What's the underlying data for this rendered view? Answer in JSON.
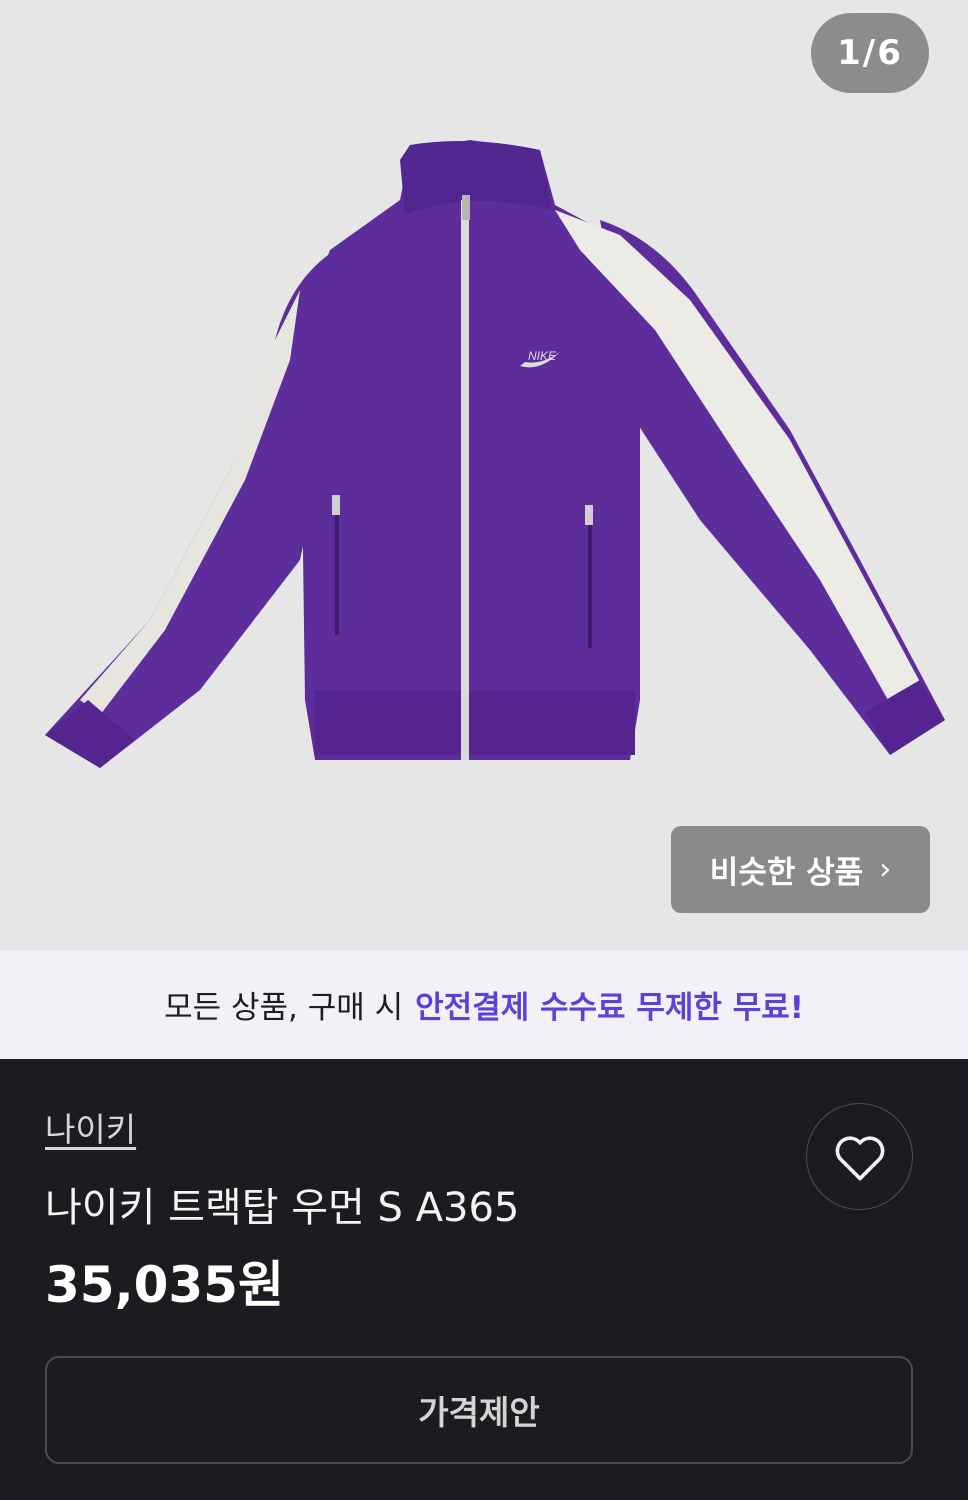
{
  "gallery": {
    "counter": "1/6",
    "similar_label": "비슷한 상품",
    "similar_chevron": "›",
    "image_subject": "purple track jacket with white sleeve stripes",
    "logo_text": "NIKE"
  },
  "banner": {
    "text": "모든 상품, 구매 시",
    "highlight": "안전결제 수수료 무제한 무료!",
    "highlight_color": "#5a41d8"
  },
  "product": {
    "brand": "나이키",
    "title": "나이키 트랙탑 우먼 S A365",
    "price": "35,035원",
    "like_icon": "heart-outline-icon",
    "offer_label": "가격제안"
  },
  "colors": {
    "jacket": "#5e2d9c",
    "stripe": "#ecebe6",
    "background_dark": "#1b1c1f"
  }
}
